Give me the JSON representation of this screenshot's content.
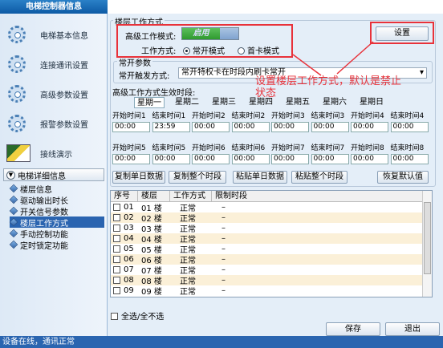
{
  "window": {
    "title": "电梯控制器信息"
  },
  "sidebar": {
    "items": [
      {
        "label": "电梯基本信息",
        "icon": "gear-icon"
      },
      {
        "label": "连接通讯设置",
        "icon": "gear-icon"
      },
      {
        "label": "高级参数设置",
        "icon": "gear-icon"
      },
      {
        "label": "报警参数设置",
        "icon": "gear-icon"
      },
      {
        "label": "接线演示",
        "icon": "chart-icon"
      }
    ],
    "detail_header": "电梯详细信息",
    "detail_items": [
      {
        "label": "楼层信息"
      },
      {
        "label": "驱动输出时长"
      },
      {
        "label": "开关信号参数"
      },
      {
        "label": "楼层工作方式"
      },
      {
        "label": "手动控制功能"
      },
      {
        "label": "定时锁定功能"
      }
    ]
  },
  "floor_mode": {
    "group_title": "楼层工作方式",
    "advanced_mode_label": "高级工作模式:",
    "toggle_on_label": "启用",
    "work_mode_label": "工作方式:",
    "radio_normal": "常开模式",
    "radio_first_card": "首卡模式",
    "settings_button": "设置"
  },
  "normal_open": {
    "group_title": "常开参数",
    "trigger_label": "常开触发方式:",
    "trigger_value": "常开特权卡在时段内刷卡常开"
  },
  "annotation": {
    "text_line1": "设置楼层工作方式，默认是禁止",
    "text_line2": "状态"
  },
  "time_slots": {
    "title": "高级工作方式生效时段:",
    "days": [
      "星期一",
      "星期二",
      "星期三",
      "星期四",
      "星期五",
      "星期六",
      "星期日"
    ],
    "row1": [
      {
        "label": "开始时间1",
        "value": "00:00"
      },
      {
        "label": "结束时间1",
        "value": "23:59"
      },
      {
        "label": "开始时间2",
        "value": "00:00"
      },
      {
        "label": "结束时间2",
        "value": "00:00"
      },
      {
        "label": "开始时间3",
        "value": "00:00"
      },
      {
        "label": "结束时间3",
        "value": "00:00"
      },
      {
        "label": "开始时间4",
        "value": "00:00"
      },
      {
        "label": "结束时间4",
        "value": "00:00"
      }
    ],
    "row2": [
      {
        "label": "开始时间5",
        "value": "00:00"
      },
      {
        "label": "结束时间5",
        "value": "00:00"
      },
      {
        "label": "开始时间6",
        "value": "00:00"
      },
      {
        "label": "结束时间6",
        "value": "00:00"
      },
      {
        "label": "开始时间7",
        "value": "00:00"
      },
      {
        "label": "结束时间7",
        "value": "00:00"
      },
      {
        "label": "开始时间8",
        "value": "00:00"
      },
      {
        "label": "结束时间8",
        "value": "00:00"
      }
    ]
  },
  "actions": {
    "copy_single": "复制单日数据",
    "copy_all": "复制整个时段",
    "paste_single": "粘贴单日数据",
    "paste_all": "粘贴整个时段",
    "restore_default": "恢复默认值"
  },
  "table": {
    "columns": [
      "序号",
      "楼层",
      "工作方式",
      "限制时段"
    ],
    "rows": [
      {
        "no": "01",
        "floor": "01 楼",
        "mode": "正常",
        "limit": "–"
      },
      {
        "no": "02",
        "floor": "02 楼",
        "mode": "正常",
        "limit": "–"
      },
      {
        "no": "03",
        "floor": "03 楼",
        "mode": "正常",
        "limit": "–"
      },
      {
        "no": "04",
        "floor": "04 楼",
        "mode": "正常",
        "limit": "–"
      },
      {
        "no": "05",
        "floor": "05 楼",
        "mode": "正常",
        "limit": "–"
      },
      {
        "no": "06",
        "floor": "06 楼",
        "mode": "正常",
        "limit": "–"
      },
      {
        "no": "07",
        "floor": "07 楼",
        "mode": "正常",
        "limit": "–"
      },
      {
        "no": "08",
        "floor": "08 楼",
        "mode": "正常",
        "limit": "–"
      },
      {
        "no": "09",
        "floor": "09 楼",
        "mode": "正常",
        "limit": "–"
      }
    ]
  },
  "footer": {
    "select_all": "全选/全不选",
    "save": "保存",
    "exit": "退出",
    "status": "设备在线，通讯正常"
  },
  "colors": {
    "annotation": "#e8323a",
    "selected": "#2a64b0",
    "status_bar": "#2a65b0",
    "toggle_on": "#2f9a2f"
  }
}
